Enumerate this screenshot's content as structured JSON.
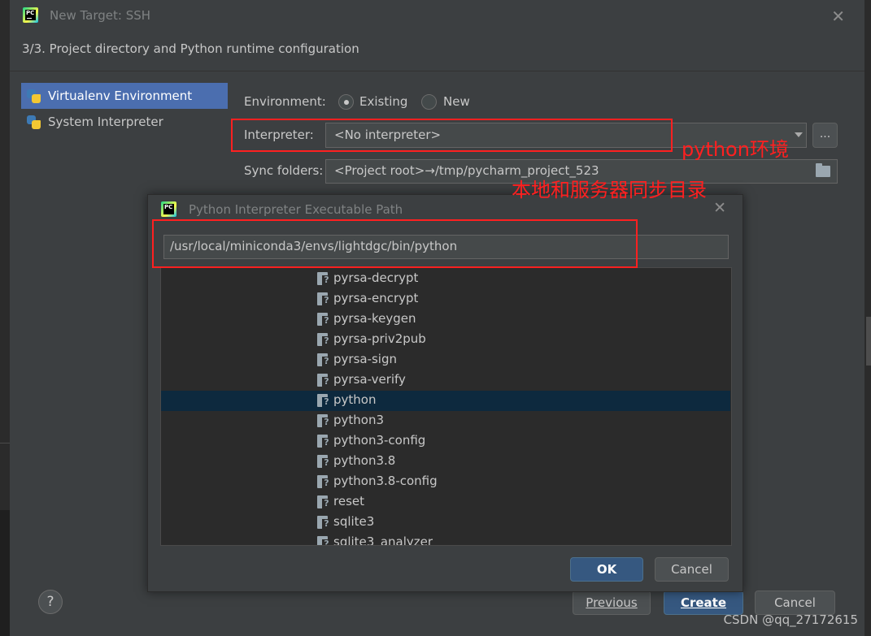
{
  "main_dialog": {
    "title": "New Target: SSH",
    "step_title": "3/3. Project directory and Python runtime configuration",
    "sidebar": {
      "items": [
        {
          "label": "Virtualenv Environment",
          "selected": true
        },
        {
          "label": "System Interpreter",
          "selected": false
        }
      ]
    },
    "environment": {
      "label": "Environment:",
      "options": [
        {
          "label": "Existing",
          "checked": true
        },
        {
          "label": "New",
          "checked": false
        }
      ]
    },
    "interpreter": {
      "label": "Interpreter:",
      "value": "<No interpreter>",
      "browse_label": "..."
    },
    "sync_folders": {
      "label": "Sync folders:",
      "value": "<Project root>→/tmp/pycharm_project_523"
    },
    "footer": {
      "help_label": "?",
      "previous_label": "Previous",
      "create_label": "Create",
      "cancel_label": "Cancel"
    }
  },
  "sub_dialog": {
    "title": "Python Interpreter Executable Path",
    "path_value": "/usr/local/miniconda3/envs/lightdgc/bin/python",
    "files": [
      {
        "name": "pyrsa-decrypt",
        "selected": false
      },
      {
        "name": "pyrsa-encrypt",
        "selected": false
      },
      {
        "name": "pyrsa-keygen",
        "selected": false
      },
      {
        "name": "pyrsa-priv2pub",
        "selected": false
      },
      {
        "name": "pyrsa-sign",
        "selected": false
      },
      {
        "name": "pyrsa-verify",
        "selected": false
      },
      {
        "name": "python",
        "selected": true
      },
      {
        "name": "python3",
        "selected": false
      },
      {
        "name": "python3-config",
        "selected": false
      },
      {
        "name": "python3.8",
        "selected": false
      },
      {
        "name": "python3.8-config",
        "selected": false
      },
      {
        "name": "reset",
        "selected": false
      },
      {
        "name": "sqlite3",
        "selected": false
      },
      {
        "name": "sqlite3_analyzer",
        "selected": false
      }
    ],
    "ok_label": "OK",
    "cancel_label": "Cancel"
  },
  "annotations": {
    "python_env_note": "python环境",
    "sync_note": "本地和服务器同步目录"
  },
  "watermark": "CSDN @qq_27172615",
  "colors": {
    "selection_blue": "#4b6eaf",
    "annotation_red": "#ff2020",
    "primary_button": "#365880"
  }
}
